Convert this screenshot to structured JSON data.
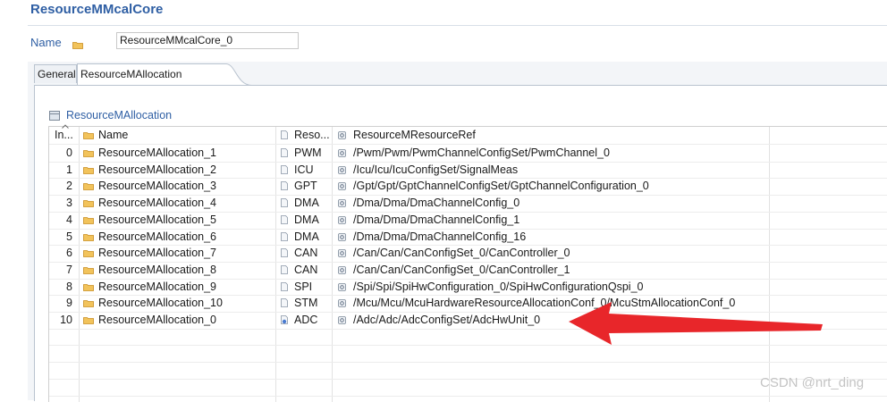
{
  "header": {
    "title": "ResourceMMcalCore"
  },
  "name_field": {
    "label": "Name",
    "value": "ResourceMMcalCore_0"
  },
  "tabs": [
    {
      "label": "General"
    },
    {
      "label": "ResourceMAllocation"
    }
  ],
  "section": {
    "title": "ResourceMAllocation"
  },
  "table": {
    "columns": {
      "index": "In...",
      "name": "Name",
      "resource": "Reso...",
      "ref": "ResourceMResourceRef"
    },
    "rows": [
      {
        "index": "0",
        "name": "ResourceMAllocation_1",
        "resource": "PWM",
        "ref": "/Pwm/Pwm/PwmChannelConfigSet/PwmChannel_0"
      },
      {
        "index": "1",
        "name": "ResourceMAllocation_2",
        "resource": "ICU",
        "ref": "/Icu/Icu/IcuConfigSet/SignalMeas"
      },
      {
        "index": "2",
        "name": "ResourceMAllocation_3",
        "resource": "GPT",
        "ref": "/Gpt/Gpt/GptChannelConfigSet/GptChannelConfiguration_0"
      },
      {
        "index": "3",
        "name": "ResourceMAllocation_4",
        "resource": "DMA",
        "ref": "/Dma/Dma/DmaChannelConfig_0"
      },
      {
        "index": "4",
        "name": "ResourceMAllocation_5",
        "resource": "DMA",
        "ref": "/Dma/Dma/DmaChannelConfig_1"
      },
      {
        "index": "5",
        "name": "ResourceMAllocation_6",
        "resource": "DMA",
        "ref": "/Dma/Dma/DmaChannelConfig_16"
      },
      {
        "index": "6",
        "name": "ResourceMAllocation_7",
        "resource": "CAN",
        "ref": "/Can/Can/CanConfigSet_0/CanController_0"
      },
      {
        "index": "7",
        "name": "ResourceMAllocation_8",
        "resource": "CAN",
        "ref": "/Can/Can/CanConfigSet_0/CanController_1"
      },
      {
        "index": "8",
        "name": "ResourceMAllocation_9",
        "resource": "SPI",
        "ref": "/Spi/Spi/SpiHwConfiguration_0/SpiHwConfigurationQspi_0"
      },
      {
        "index": "9",
        "name": "ResourceMAllocation_10",
        "resource": "STM",
        "ref": "/Mcu/Mcu/McuHardwareResourceAllocationConf_0/McuStmAllocationConf_0"
      },
      {
        "index": "10",
        "name": "ResourceMAllocation_0",
        "resource": "ADC",
        "ref": "/Adc/Adc/AdcConfigSet/AdcHwUnit_0"
      }
    ]
  },
  "watermark": "CSDN @nrt_ding",
  "colors": {
    "title": "#2f5fa4",
    "arrow": "#e8262a",
    "folder": "#e8b64c"
  },
  "icons": {
    "folder": "folder-icon",
    "file": "file-icon",
    "reference": "reference-icon",
    "sort": "sort-up-icon"
  }
}
